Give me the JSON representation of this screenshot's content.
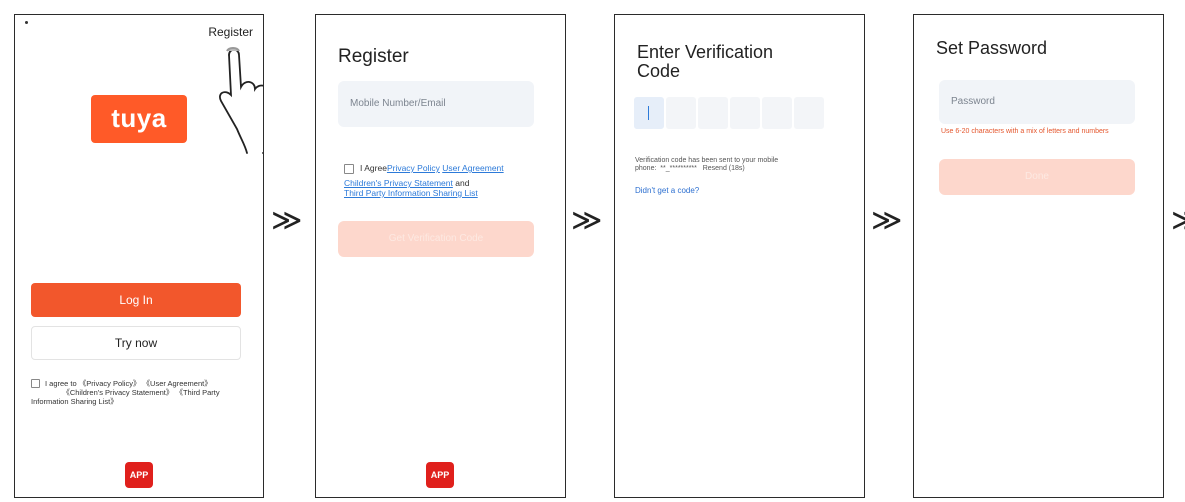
{
  "screen1": {
    "register_link": "Register",
    "logo_text": "tuya",
    "login_label": "Log In",
    "try_label": "Try now",
    "agree_line1": "I agree to 《Privacy Policy》 《User Agreement》",
    "agree_line2": "《Children's Privacy Statement》 《Third Party",
    "agree_line3": "Information Sharing List》",
    "app_badge": "APP"
  },
  "screen2": {
    "title": "Register",
    "input_placeholder": "Mobile Number/Email",
    "agree_prefix": "I Agree",
    "privacy_link": "Privacy Policy",
    "user_agreement_link": "User Agreement",
    "children_link": "Children's Privacy Statement",
    "and_text": " and",
    "third_party_link": "Third Party Information Sharing List",
    "button_label": "Get Verification Code",
    "app_badge": "APP"
  },
  "screen3": {
    "title_line1": "Enter Verification",
    "title_line2": "Code",
    "sent_line1": "Verification code has been sent to your mobile",
    "sent_line2": "phone:  **_**********   Resend (18s)",
    "no_code_link": "Didn't get a code?"
  },
  "screen4": {
    "title": "Set Password",
    "input_placeholder": "Password",
    "hint_text": "Use 6-20 characters with a mix of letters and numbers",
    "button_label": "Done"
  },
  "arrows": {
    "arrow1": "≫",
    "arrow2": "≫",
    "arrow3": "≫",
    "arrow4": "≫"
  },
  "colors": {
    "brand_orange": "#f2572c",
    "link_blue": "#2c7ad9",
    "field_bg": "#f1f4f8",
    "app_red": "#e0201c"
  }
}
